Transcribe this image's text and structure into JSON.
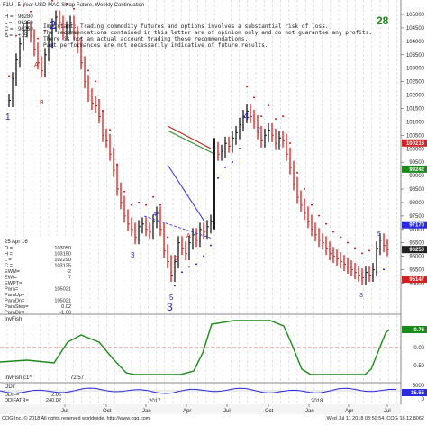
{
  "window": {
    "title": "F1U - 5-Year USD MAC Swap Future, Weekly Continuation",
    "ohlc": [
      [
        "H =",
        "96280"
      ],
      [
        "L =",
        "96250"
      ],
      [
        "C =",
        "96250"
      ],
      [
        "Δ =",
        "+15"
      ]
    ],
    "corner_number": "28"
  },
  "disclaimer": [
    "Important: Trading commodity futures and options involves a substantial risk of loss.",
    "The recommendations contained in this letter are of opinion only and do not guarantee any profits.",
    "There is not an actual account trading these recommendations.",
    "Past performances are not necessarily indicative of future results."
  ],
  "info_box": {
    "date": "25 Apr 16",
    "rows": [
      [
        "O =",
        "103050"
      ],
      [
        "H =",
        "103150"
      ],
      [
        "L =",
        "102290"
      ],
      [
        "C =",
        "103125"
      ],
      [
        "EWM=",
        "-2"
      ],
      [
        "EWI=",
        "7"
      ],
      [
        "EWPT=",
        ""
      ],
      [
        "Para=",
        "105021"
      ],
      [
        "ParaUp=",
        ""
      ],
      [
        "ParaDn=",
        "105021"
      ],
      [
        "ParaStep=",
        "0.02"
      ],
      [
        "ParaDir=",
        "-1.00"
      ]
    ]
  },
  "wave_labels": {
    "w2": "2",
    "w1": "1",
    "w3": "3",
    "w5": "5",
    "w3b": "3",
    "w4": "4",
    "w3c": "3",
    "w4a": "4",
    "wA": "A",
    "wB": "B",
    "wA2": "A",
    "wB2": "B",
    "w4b": "4",
    "w2c": "2",
    "w5b": "5",
    "wA3": "A"
  },
  "price_axis": {
    "ticks": [
      "105000",
      "104500",
      "104000",
      "103500",
      "103000",
      "102500",
      "102000",
      "101500",
      "101000",
      "100500",
      "100000",
      "99500",
      "99000",
      "98500",
      "98000",
      "97500",
      "97000",
      "96500",
      "96000",
      "95500",
      "95000"
    ],
    "badges": [
      {
        "label": "100216",
        "color": "#d42020"
      },
      {
        "label": "99242",
        "color": "#1a8a1a"
      },
      {
        "label": "97170",
        "color": "#2a2ae0"
      },
      {
        "label": "96250",
        "color": "#222222"
      },
      {
        "label": "95147",
        "color": "#d42020"
      }
    ]
  },
  "invfish_panel": {
    "label": "InvFish",
    "bottom_label": "InvFish.c1^",
    "bottom_value": "72.57",
    "ticks": [
      "0.50",
      "0.00",
      "-0.50"
    ],
    "badge": "0.76"
  },
  "ddif_panel": {
    "label": "DDif",
    "rows": [
      [
        "DDIF=",
        "2.06"
      ],
      [
        "DDIFATR=",
        "240.02"
      ]
    ],
    "ticks": [
      "5000",
      "0"
    ],
    "badge": "15.55",
    "years": [
      "2017",
      "2018"
    ]
  },
  "time_axis": [
    "Jul",
    "Oct",
    "Jan",
    "Apr",
    "Jul",
    "Oct",
    "Jan",
    "Apr",
    "Jul"
  ],
  "footer": {
    "left": "CQG Inc. © 2018 All rights reserved worldwide. http://www.cqg.com",
    "right": "Wed Jul 11 2018 08:50:54, CQG 18.12.8062"
  },
  "colors": {
    "up": "#1a1a1a",
    "down": "#d42020",
    "para_dn": "#d42020",
    "para_up": "#2a2ae0",
    "invfish": "#1a8a1a",
    "ddif": "#2a2ae0",
    "wave_label": "#2a2ab0"
  }
}
